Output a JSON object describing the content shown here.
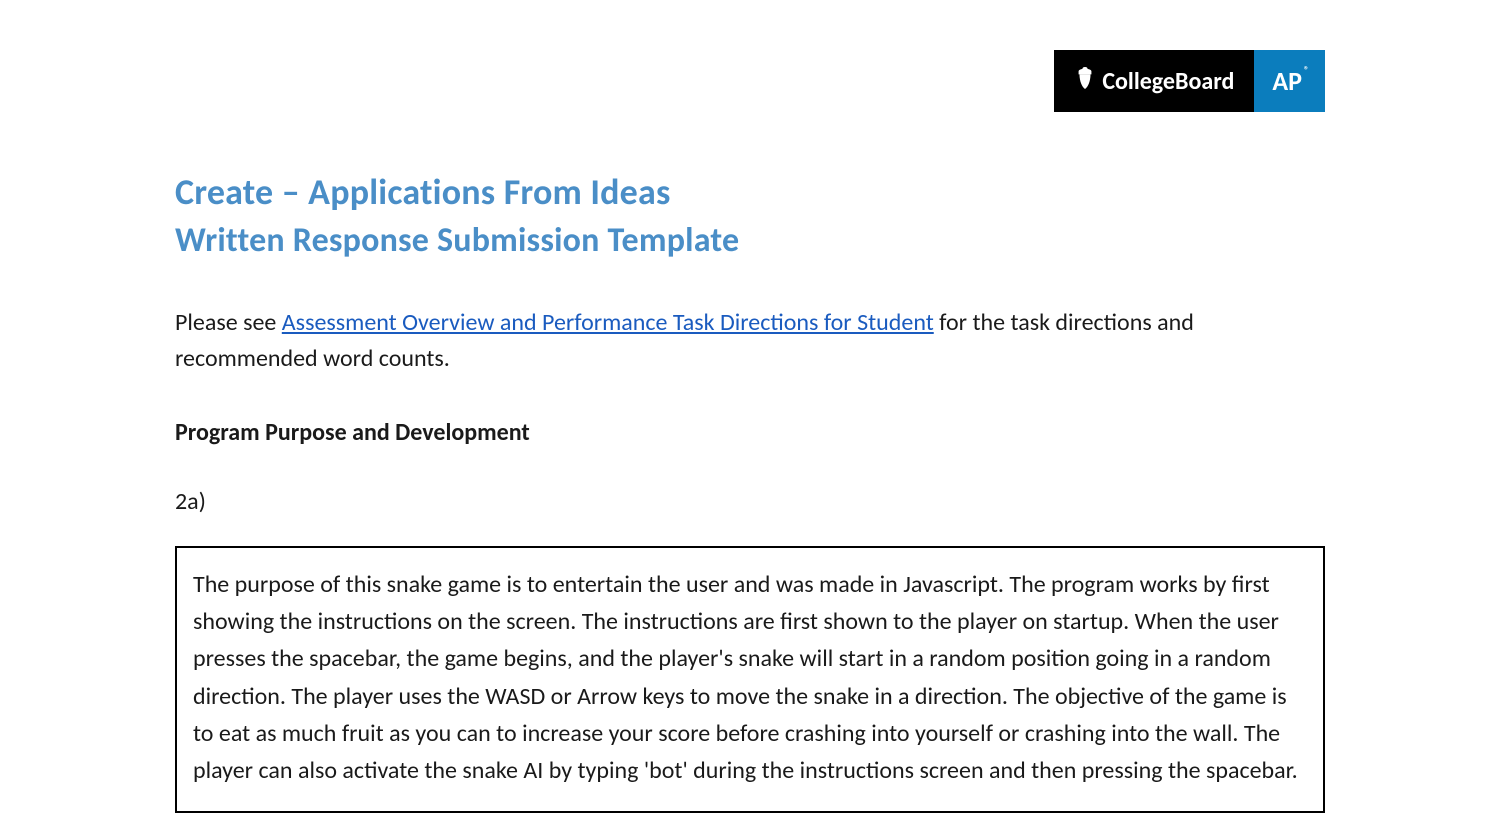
{
  "brand": {
    "collegeboard_label": "CollegeBoard",
    "ap_label": "AP"
  },
  "headings": {
    "title_line_1": "Create – Applications From Ideas",
    "title_line_2": "Written Response Submission Template",
    "section": "Program Purpose and Development",
    "question_label": "2a)"
  },
  "intro": {
    "prefix": "Please see ",
    "link_text": "Assessment Overview and Performance Task Directions for Student",
    "suffix": " for the task directions and recommended word counts."
  },
  "response_2a": "The purpose of this snake game is to entertain the user and was made in Javascript. The program works by first showing the instructions on the screen. The instructions are first shown to the player on startup. When the user presses the spacebar, the game begins, and the player's snake will start in a random position going in a random direction. The player uses the WASD or Arrow keys to move the snake in a direction. The objective of the game is to eat as much fruit as you can to increase your score before crashing into yourself or crashing into the wall. The player can also activate the snake AI by typing 'bot' during the instructions screen and then pressing the spacebar."
}
